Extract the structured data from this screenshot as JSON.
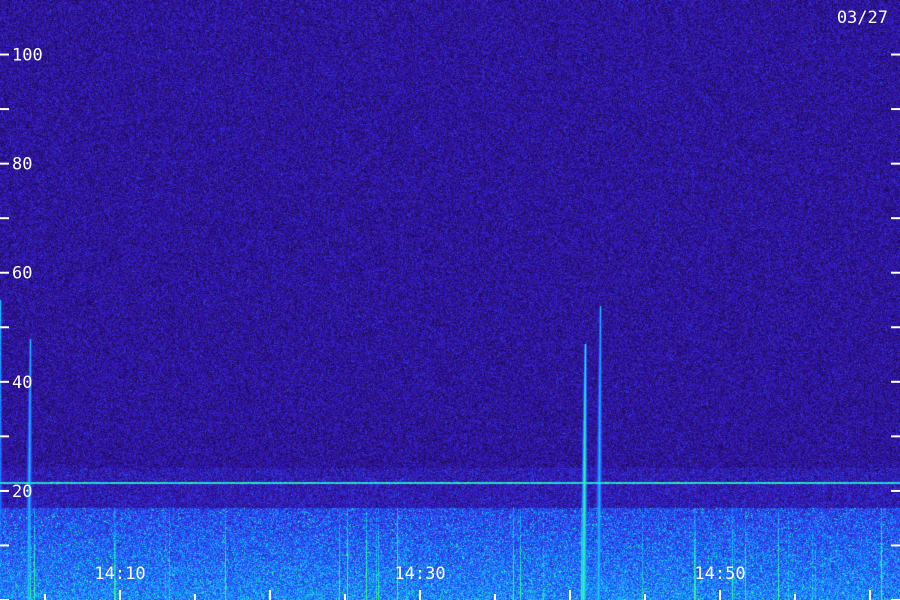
{
  "date_label": "03/27",
  "chart_data": {
    "type": "heatmap",
    "title": "",
    "xlabel": "",
    "ylabel": "",
    "x_range": [
      "14:02",
      "15:02"
    ],
    "ylim": [
      0,
      110
    ],
    "y_ticks": [
      0,
      10,
      20,
      30,
      40,
      50,
      60,
      70,
      80,
      90,
      100
    ],
    "y_tick_labels": [
      {
        "value": 20,
        "label": "20"
      },
      {
        "value": 40,
        "label": "40"
      },
      {
        "value": 60,
        "label": "60"
      },
      {
        "value": 80,
        "label": "80"
      },
      {
        "value": 100,
        "label": "100"
      }
    ],
    "x_tick_labels": [
      {
        "value": "14:10",
        "label": "14:10"
      },
      {
        "value": "14:30",
        "label": "14:30"
      },
      {
        "value": "14:50",
        "label": "14:50"
      }
    ],
    "x_minor_ticks_minutes": 5,
    "colormap": [
      "#1a0a52",
      "#3a18c0",
      "#1f5fff",
      "#19c6ff",
      "#3cff7a"
    ],
    "noise_floor_color": "#2a1590",
    "features": [
      {
        "kind": "bright-band",
        "y_range": [
          0,
          17
        ],
        "intensity": "high"
      },
      {
        "kind": "horizontal-line",
        "y": 21.5,
        "color": "#3cff7a"
      },
      {
        "kind": "vertical-streak",
        "time": "14:02",
        "y_range": [
          0,
          55
        ],
        "color": "#19c6ff"
      },
      {
        "kind": "vertical-streak",
        "time": "14:04",
        "y_range": [
          0,
          48
        ],
        "color": "#1f5fff"
      },
      {
        "kind": "vertical-streak",
        "time": "14:41",
        "y_range": [
          0,
          47
        ],
        "color": "#3cff7a"
      },
      {
        "kind": "vertical-streak",
        "time": "14:42",
        "y_range": [
          0,
          54
        ],
        "color": "#19c6ff"
      }
    ]
  }
}
